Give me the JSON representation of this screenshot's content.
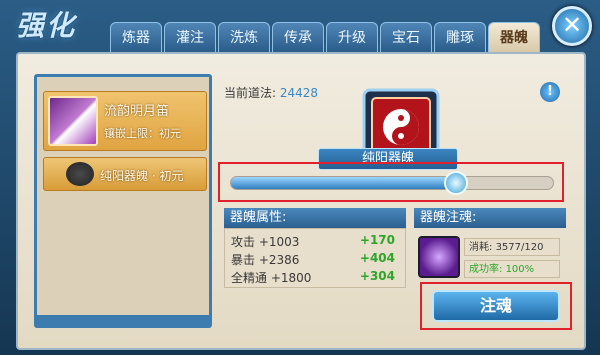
{
  "header": {
    "title": "强化",
    "tabs": [
      {
        "label": "炼器",
        "active": false
      },
      {
        "label": "灌注",
        "active": false
      },
      {
        "label": "洗炼",
        "active": false
      },
      {
        "label": "传承",
        "active": false
      },
      {
        "label": "升级",
        "active": false
      },
      {
        "label": "宝石",
        "active": false
      },
      {
        "label": "雕琢",
        "active": false
      },
      {
        "label": "器魄",
        "active": true
      }
    ],
    "close_icon": "close-icon"
  },
  "left_list": {
    "items": [
      {
        "name": "流韵明月笛",
        "sub": "镶嵌上限：初元",
        "icon": "flute-icon"
      },
      {
        "name": "纯阳器魄 · 初元",
        "icon": "soul-icon"
      }
    ]
  },
  "main": {
    "daofa_label": "当前道法:",
    "daofa_value": "24428",
    "info_icon": "info-icon",
    "soul_name": "纯阳器魄",
    "progress": 0.7,
    "accent_color": "#e0212c"
  },
  "attributes": {
    "heading": "器魄属性:",
    "rows": [
      {
        "name": "攻击 +1003",
        "gain": "+170"
      },
      {
        "name": "暴击 +2386",
        "gain": "+404"
      },
      {
        "name": "全精通 +1800",
        "gain": "+304"
      }
    ]
  },
  "injection": {
    "heading": "器魄注魂:",
    "cost_label": "消耗:",
    "cost_value": "3577/120",
    "rate_label": "成功率:",
    "rate_value": "100%",
    "button_label": "注魂"
  }
}
